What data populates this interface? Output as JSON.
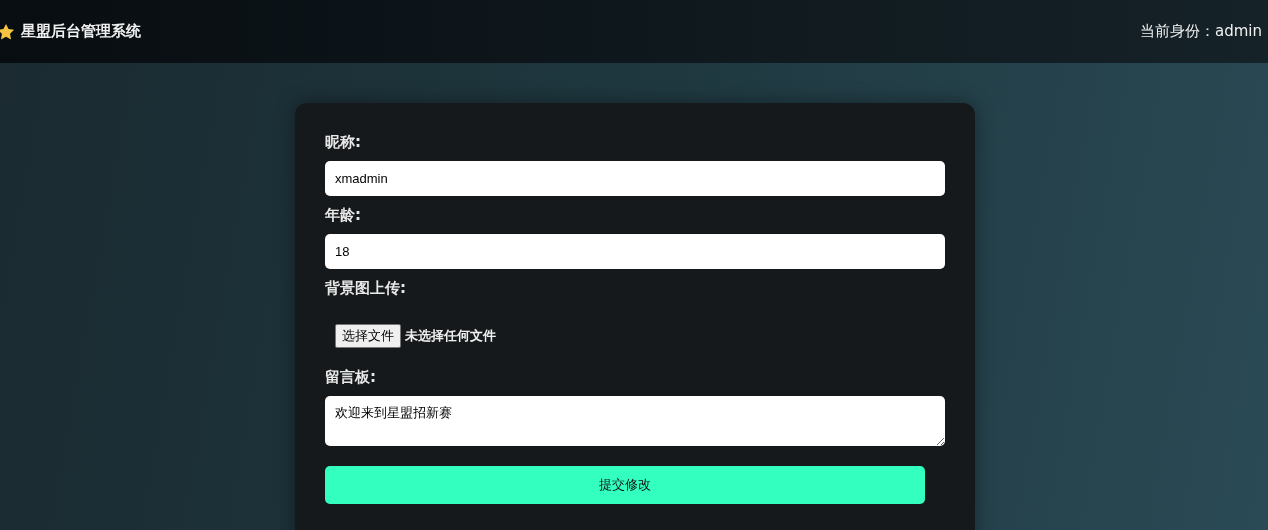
{
  "header": {
    "title": "星盟后台管理系统",
    "identity": "当前身份：admin"
  },
  "form": {
    "fields": [
      {
        "kind": "text",
        "label": "昵称:",
        "value": "xmadmin"
      },
      {
        "kind": "text",
        "label": "年龄:",
        "value": "18"
      },
      {
        "kind": "file",
        "label": "背景图上传:",
        "button": "选择文件",
        "status": "未选择任何文件"
      },
      {
        "kind": "textarea",
        "label": "留言板:",
        "value": "欢迎来到星盟招新赛"
      }
    ],
    "submit": "提交修改"
  }
}
